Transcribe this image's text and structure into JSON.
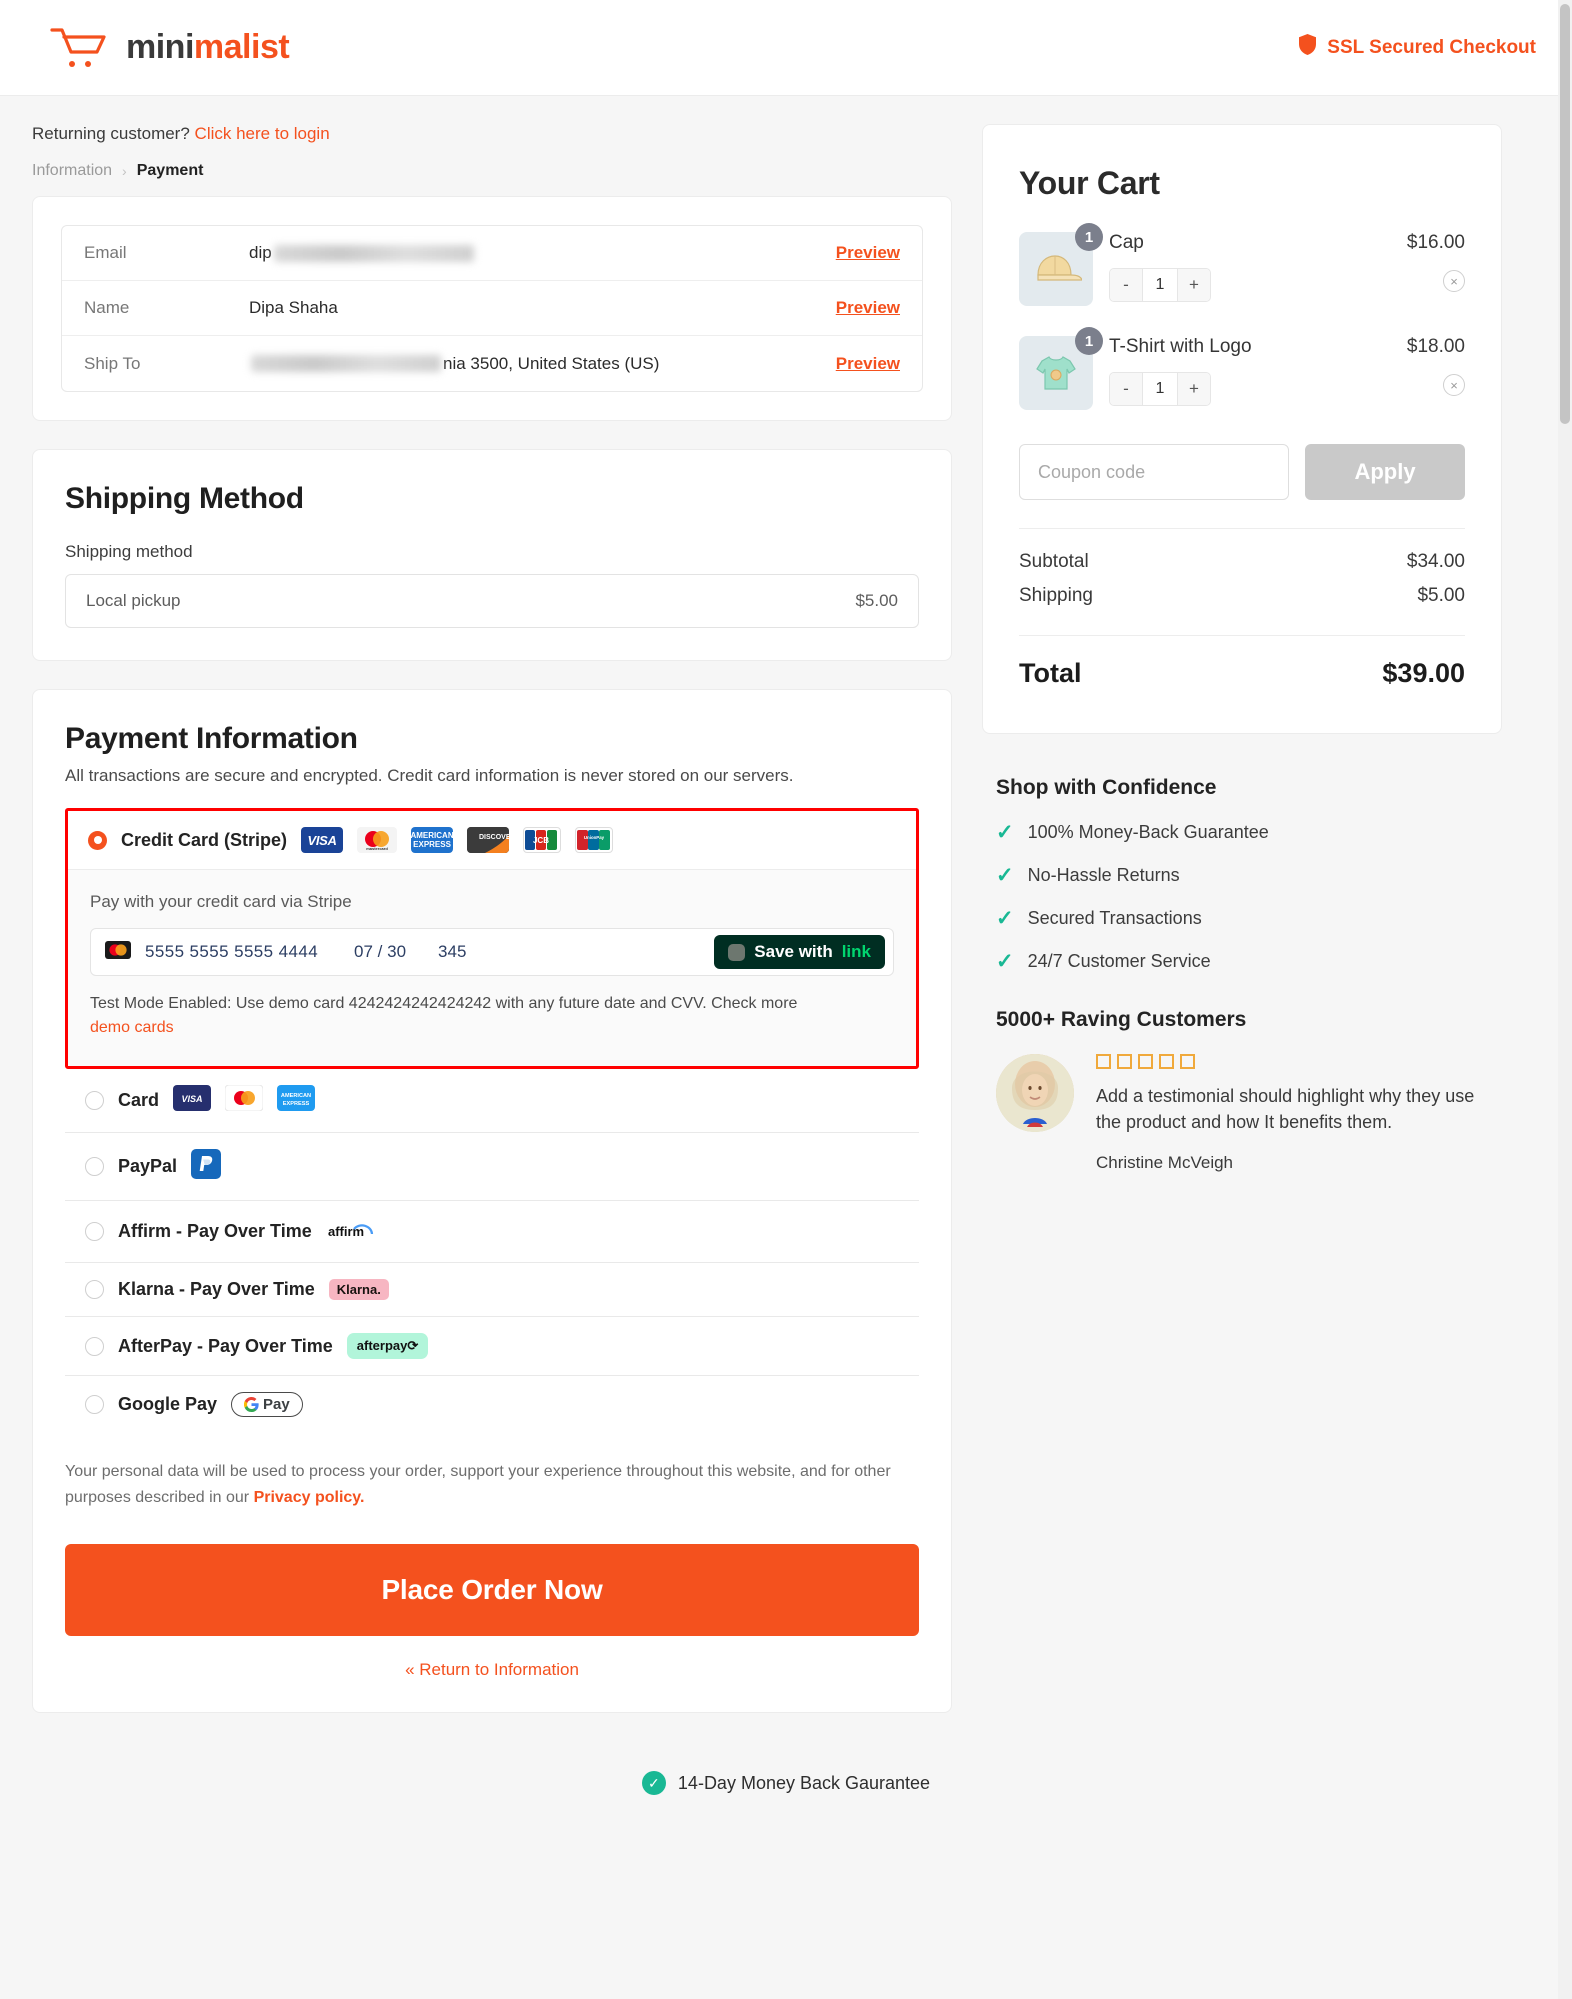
{
  "header": {
    "brand_first": "mini",
    "brand_second": "malist",
    "cart_icon": "shopping-cart-icon",
    "ssl_text": "SSL Secured Checkout",
    "ssl_icon": "shield-icon",
    "accent_color": "#f4511e"
  },
  "login_prompt": {
    "text": "Returning customer?",
    "link": "Click here to login"
  },
  "breadcrumb": {
    "step1": "Information",
    "separator": "›",
    "step2": "Payment"
  },
  "summary": {
    "rows": [
      {
        "label": "Email",
        "value": "dip",
        "redacted": true,
        "action": "Preview"
      },
      {
        "label": "Name",
        "value": "Dipa  Shaha",
        "redacted": false,
        "action": "Preview"
      },
      {
        "label": "Ship To",
        "value": "nia 3500, United States (US)",
        "redacted": true,
        "action": "Preview"
      }
    ]
  },
  "shipping": {
    "title": "Shipping Method",
    "field_label": "Shipping method",
    "option_name": "Local pickup",
    "option_price": "$5.00"
  },
  "payment": {
    "title": "Payment Information",
    "subtitle": "All transactions are secure and encrypted. Credit card information is never stored on our servers.",
    "stripe": {
      "label": "Credit Card (Stripe)",
      "selected": true,
      "brands": [
        "VISA",
        "mastercard",
        "AMERICAN EXPRESS",
        "DISCOVER",
        "JCB",
        "UnionPay"
      ],
      "hint": "Pay with your credit card via Stripe",
      "card_number": "5555 5555 5555 4444",
      "card_expiry": "07 / 30",
      "card_cvc": "345",
      "card_brand_icon": "mastercard-icon",
      "link_button_text": "Save with",
      "link_button_brand": "link",
      "test_note": "Test Mode Enabled: Use demo card 4242424242424242 with any future date and CVV. Check more",
      "demo_cards_link": "demo cards"
    },
    "methods": [
      {
        "label": "Card",
        "logos": [
          "VISA",
          "mastercard",
          "AMERICAN EXPRESS"
        ],
        "selected": false
      },
      {
        "label": "PayPal",
        "logos": [
          "paypal"
        ],
        "selected": false
      },
      {
        "label": "Affirm - Pay Over Time",
        "logos": [
          "affirm"
        ],
        "selected": false
      },
      {
        "label": "Klarna - Pay Over Time",
        "logos": [
          "Klarna."
        ],
        "selected": false
      },
      {
        "label": "AfterPay - Pay Over Time",
        "logos": [
          "afterpay"
        ],
        "selected": false
      },
      {
        "label": "Google Pay",
        "logos": [
          "G Pay"
        ],
        "selected": false
      }
    ],
    "privacy_text": "Your personal data will be used to process your order, support your experience throughout this website, and for other purposes described in our",
    "privacy_link": "Privacy policy.",
    "place_order": "Place Order Now",
    "return_link": "« Return to Information"
  },
  "cart": {
    "title": "Your Cart",
    "items": [
      {
        "name": "Cap",
        "price": "$16.00",
        "qty": "1",
        "badge": "1",
        "thumb": "cap-thumbnail",
        "minus": "-",
        "plus": "+",
        "remove": "×"
      },
      {
        "name": "T-Shirt with Logo",
        "price": "$18.00",
        "qty": "1",
        "badge": "1",
        "thumb": "tshirt-thumbnail",
        "minus": "-",
        "plus": "+",
        "remove": "×"
      }
    ],
    "coupon_placeholder": "Coupon code",
    "apply_label": "Apply",
    "subtotal_label": "Subtotal",
    "subtotal_value": "$34.00",
    "shipping_label": "Shipping",
    "shipping_value": "$5.00",
    "total_label": "Total",
    "total_value": "$39.00"
  },
  "confidence": {
    "title": "Shop with Confidence",
    "items": [
      "100% Money-Back Guarantee",
      "No-Hassle Returns",
      "Secured Transactions",
      "24/7 Customer Service"
    ]
  },
  "testimonials": {
    "title": "5000+ Raving Customers",
    "stars": 5,
    "quote": "Add a testimonial should highlight why they use the product and how It benefits them.",
    "author": "Christine McVeigh"
  },
  "footer": {
    "guarantee": "14-Day Money Back Gaurantee",
    "icon": "check-circle-icon"
  }
}
